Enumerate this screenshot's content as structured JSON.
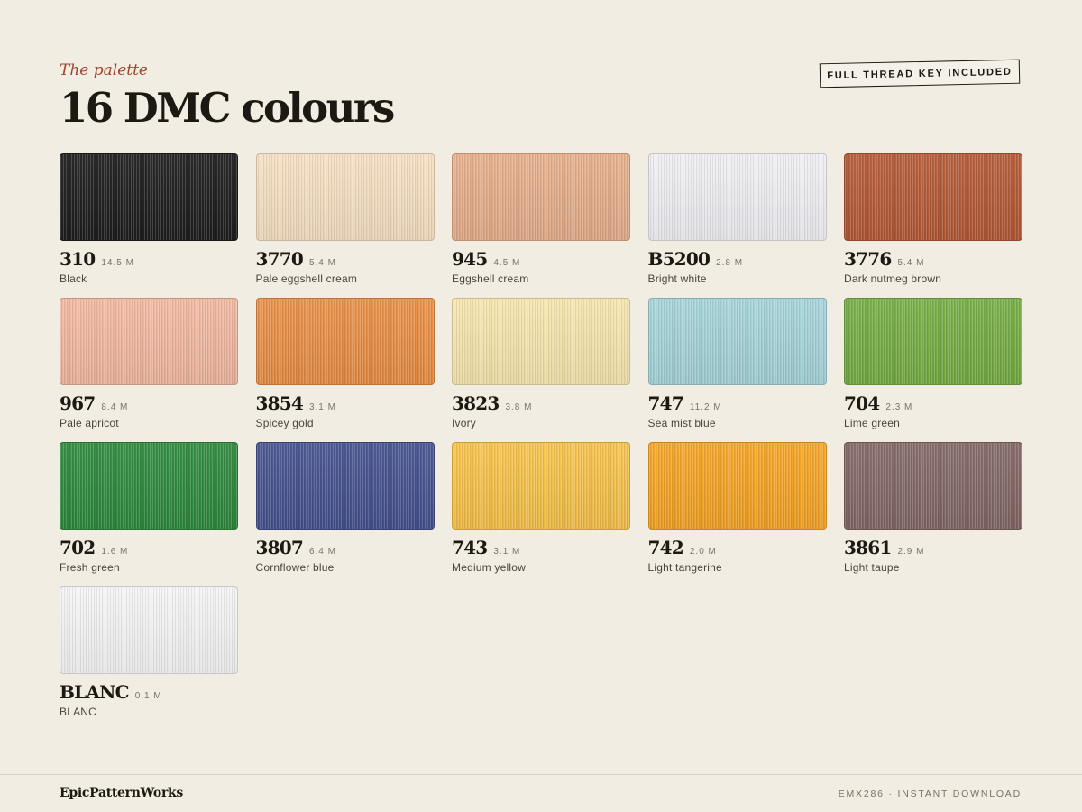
{
  "header": {
    "eyebrow": "The palette",
    "title": "16 DMC colours",
    "badge": "FULL THREAD KEY INCLUDED"
  },
  "colours": [
    {
      "code": "310",
      "meters": "14.5 M",
      "name": "Black",
      "color": "#1f1f1f"
    },
    {
      "code": "3770",
      "meters": "5.4 M",
      "name": "Pale eggshell cream",
      "color": "#f6dfc2"
    },
    {
      "code": "945",
      "meters": "4.5 M",
      "name": "Eggshell cream",
      "color": "#e6ae8b"
    },
    {
      "code": "B5200",
      "meters": "2.8 M",
      "name": "Bright white",
      "color": "#efeff3"
    },
    {
      "code": "3776",
      "meters": "5.4 M",
      "name": "Dark nutmeg brown",
      "color": "#b45a36"
    },
    {
      "code": "967",
      "meters": "8.4 M",
      "name": "Pale apricot",
      "color": "#f2b8a0"
    },
    {
      "code": "3854",
      "meters": "3.1 M",
      "name": "Spicey gold",
      "color": "#e88e45"
    },
    {
      "code": "3823",
      "meters": "3.8 M",
      "name": "Ivory",
      "color": "#f6e5ad"
    },
    {
      "code": "747",
      "meters": "11.2 M",
      "name": "Sea mist blue",
      "color": "#a5d4d9"
    },
    {
      "code": "704",
      "meters": "2.3 M",
      "name": "Lime green",
      "color": "#76ad44"
    },
    {
      "code": "702",
      "meters": "1.6 M",
      "name": "Fresh green",
      "color": "#2f8a3e"
    },
    {
      "code": "3807",
      "meters": "6.4 M",
      "name": "Cornflower blue",
      "color": "#46528f"
    },
    {
      "code": "743",
      "meters": "3.1 M",
      "name": "Medium yellow",
      "color": "#f6c24a"
    },
    {
      "code": "742",
      "meters": "2.0 M",
      "name": "Light tangerine",
      "color": "#f5a425"
    },
    {
      "code": "3861",
      "meters": "2.9 M",
      "name": "Light taupe",
      "color": "#836866"
    },
    {
      "code": "BLANC",
      "meters": "0.1 M",
      "name": "BLANC",
      "color": "#f4f4f4"
    }
  ],
  "footer": {
    "brand": "EpicPatternWorks",
    "sku": "EMX286 · INSTANT DOWNLOAD"
  }
}
